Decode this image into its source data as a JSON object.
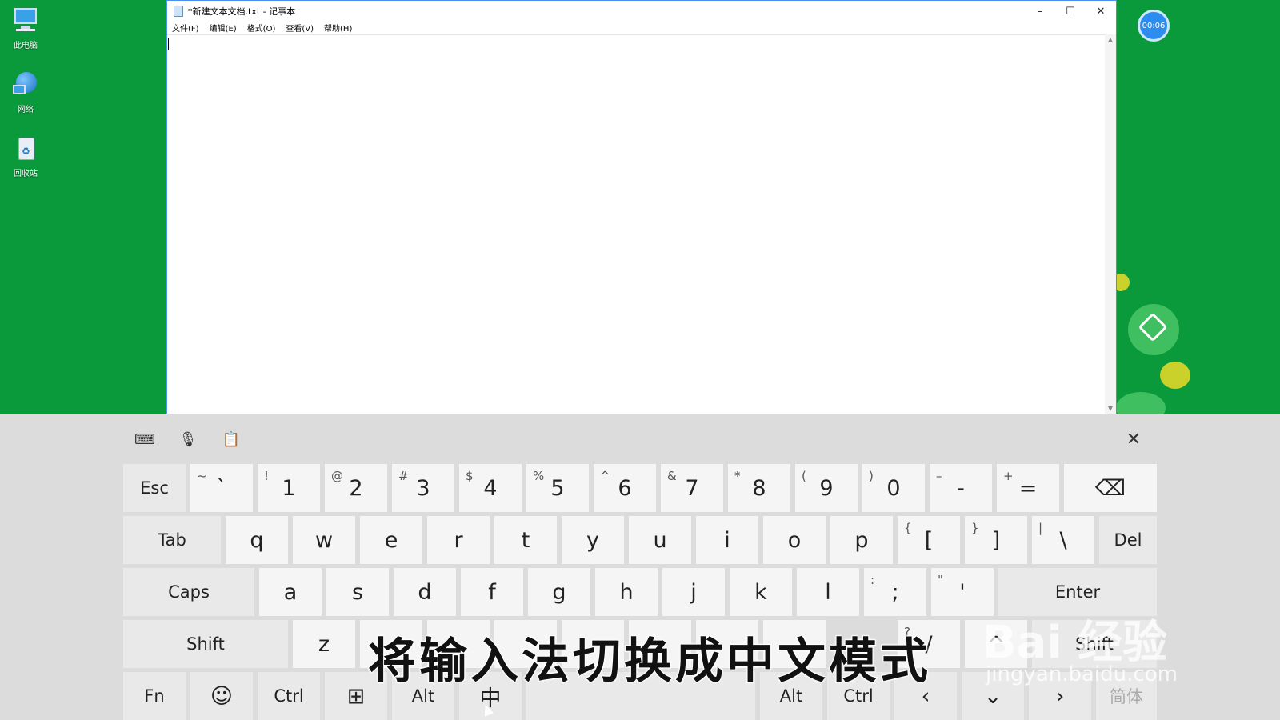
{
  "desktop": {
    "icons": [
      {
        "label": "此电脑",
        "icon": "computer-icon"
      },
      {
        "label": "网络",
        "icon": "network-icon"
      },
      {
        "label": "回收站",
        "icon": "recycle-bin-icon"
      }
    ]
  },
  "notepad": {
    "title": "*新建文本文档.txt - 记事本",
    "menu": [
      "文件(F)",
      "编辑(E)",
      "格式(O)",
      "查看(V)",
      "帮助(H)"
    ],
    "controls": {
      "minimize": "–",
      "maximize": "☐",
      "close": "✕"
    }
  },
  "timer": {
    "text": "00:06"
  },
  "keyboard": {
    "tools": [
      "keyboard-settings-icon",
      "microphone-icon",
      "clipboard-icon"
    ],
    "close": "✕",
    "rows": {
      "r1": [
        {
          "main": "Esc"
        },
        {
          "sub": "~",
          "main": "`"
        },
        {
          "sub": "!",
          "main": "1"
        },
        {
          "sub": "@",
          "main": "2"
        },
        {
          "sub": "#",
          "main": "3"
        },
        {
          "sub": "$",
          "main": "4"
        },
        {
          "sub": "%",
          "main": "5"
        },
        {
          "sub": "^",
          "main": "6"
        },
        {
          "sub": "&",
          "main": "7"
        },
        {
          "sub": "*",
          "main": "8"
        },
        {
          "sub": "(",
          "main": "9"
        },
        {
          "sub": ")",
          "main": "0"
        },
        {
          "sub": "–",
          "main": "-"
        },
        {
          "sub": "+",
          "main": "="
        },
        {
          "main": "⌫"
        }
      ],
      "r2": [
        {
          "main": "Tab"
        },
        {
          "main": "q"
        },
        {
          "main": "w"
        },
        {
          "main": "e"
        },
        {
          "main": "r"
        },
        {
          "main": "t"
        },
        {
          "main": "y"
        },
        {
          "main": "u"
        },
        {
          "main": "i"
        },
        {
          "main": "o"
        },
        {
          "main": "p"
        },
        {
          "sub": "{",
          "main": "["
        },
        {
          "sub": "}",
          "main": "]"
        },
        {
          "sub": "|",
          "main": "\\"
        },
        {
          "main": "Del"
        }
      ],
      "r3": [
        {
          "main": "Caps"
        },
        {
          "main": "a"
        },
        {
          "main": "s"
        },
        {
          "main": "d"
        },
        {
          "main": "f"
        },
        {
          "main": "g"
        },
        {
          "main": "h"
        },
        {
          "main": "j"
        },
        {
          "main": "k"
        },
        {
          "main": "l"
        },
        {
          "sub": ":",
          "main": ";"
        },
        {
          "sub": "\"",
          "main": "'"
        },
        {
          "main": "Enter"
        }
      ],
      "r4": [
        {
          "main": "Shift"
        },
        {
          "main": "z"
        },
        {
          "main": ""
        },
        {
          "main": ""
        },
        {
          "main": ""
        },
        {
          "main": ""
        },
        {
          "main": ""
        },
        {
          "main": ""
        },
        {
          "main": ""
        },
        {
          "sub": "?",
          "main": "/"
        },
        {
          "main": "^"
        },
        {
          "main": "Shift"
        }
      ],
      "r5": [
        {
          "main": "Fn"
        },
        {
          "main": "☺"
        },
        {
          "main": "Ctrl"
        },
        {
          "main": "⊞"
        },
        {
          "main": "Alt"
        },
        {
          "main": "中"
        },
        {
          "main": ""
        },
        {
          "main": "Alt"
        },
        {
          "main": "Ctrl"
        },
        {
          "main": "‹"
        },
        {
          "main": "⌄"
        },
        {
          "main": "›"
        },
        {
          "main": "简体"
        }
      ]
    }
  },
  "overlay": {
    "subtitle": "将输入法切换成中文模式",
    "watermark": "Bai 经验",
    "watermark_url": "jingyan.baidu.com"
  }
}
